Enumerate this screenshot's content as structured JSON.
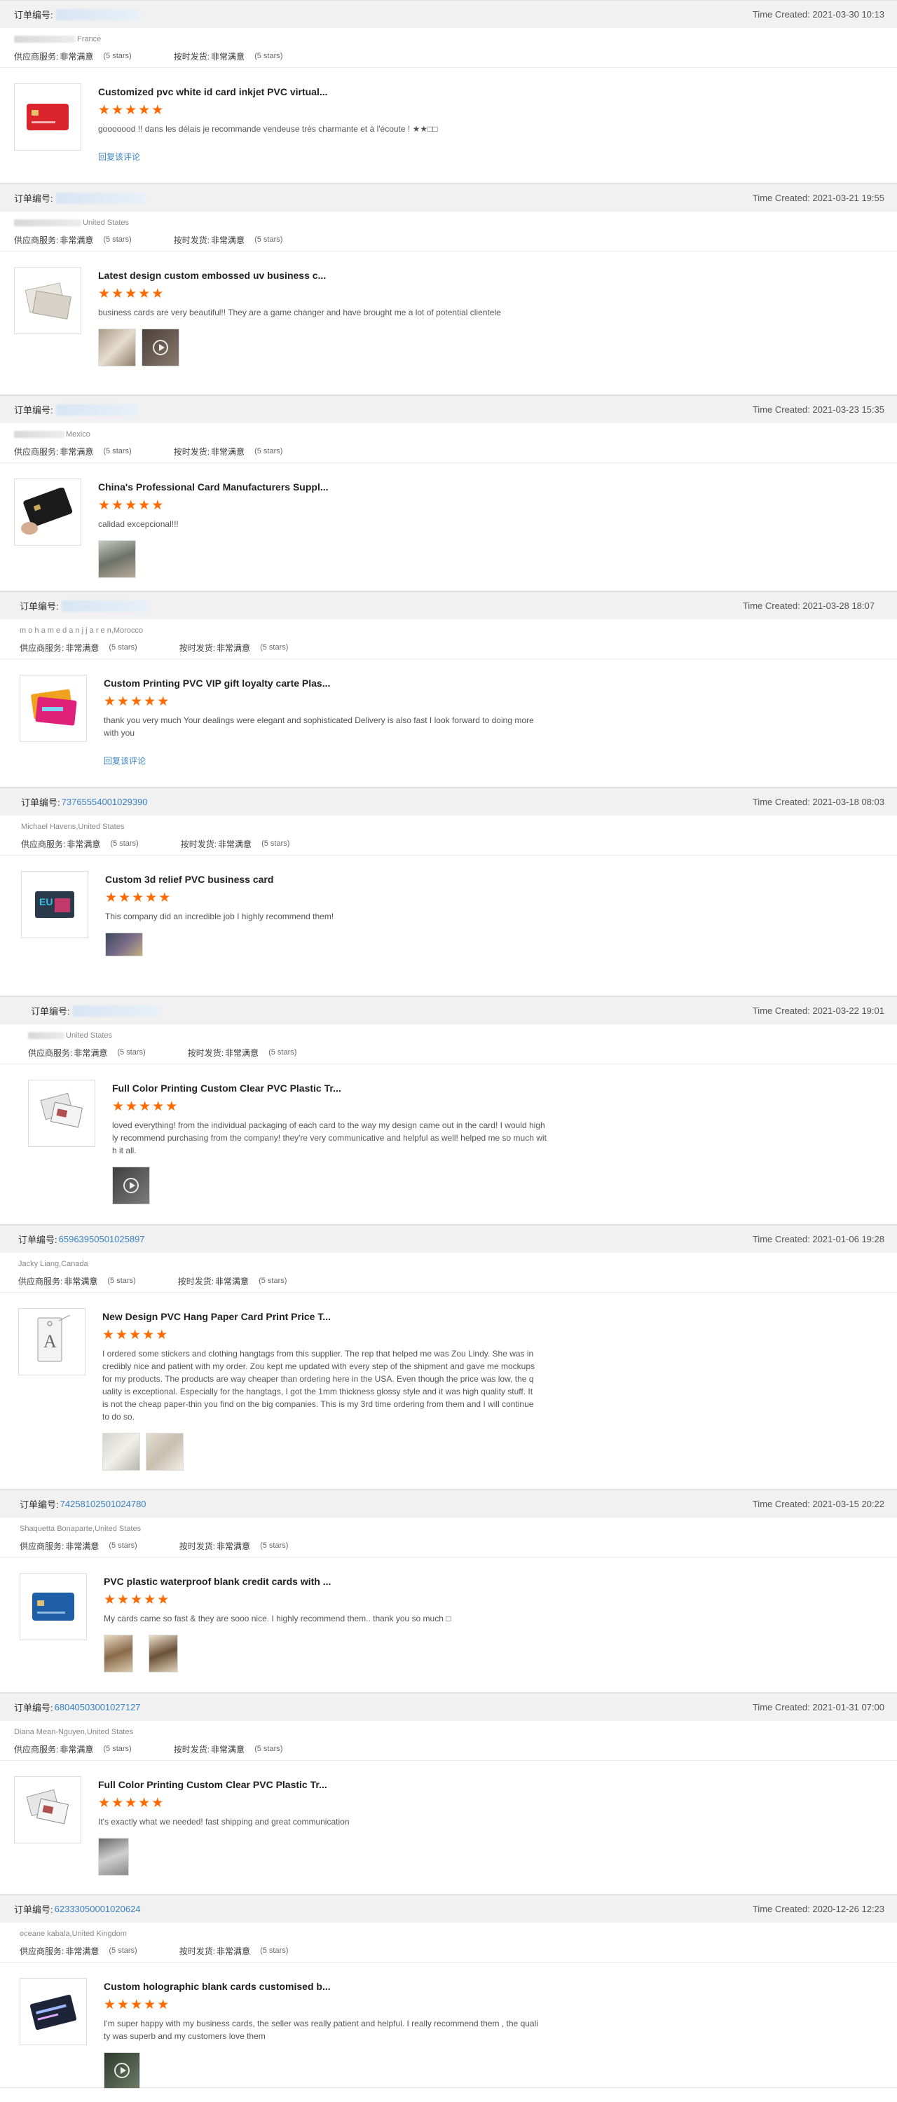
{
  "labels": {
    "order_prefix": "订单编号:",
    "service_label": "供应商服务:",
    "shipping_label": "按时发货:",
    "rating_value": "非常满意",
    "stars_text": "(5 stars)",
    "reply_label": "回复该评论",
    "time_prefix": "Time Created: "
  },
  "reviews": [
    {
      "order": "",
      "time": "2021-03-30 10:13",
      "customer": "France",
      "title": "Customized pvc white id card inkjet PVC virtual...",
      "text": "gooooood !! dans les délais je recommande vendeuse très charmante et à l'écoute ! ★★□□",
      "reply": true,
      "photos": 0
    },
    {
      "order": "",
      "time": "2021-03-21 19:55",
      "customer": "United States",
      "title": "Latest design custom embossed uv business c...",
      "text": "business cards are very beautiful!! They are a game changer and have brought me a lot of potential clientele",
      "reply": false,
      "photos": 2
    },
    {
      "order": "",
      "time": "2021-03-23 15:35",
      "customer": "Mexico",
      "title": "China's Professional Card Manufacturers Suppl...",
      "text": "calidad excepcional!!!",
      "reply": false,
      "photos": 1
    },
    {
      "order": "",
      "time": "2021-03-28 18:07",
      "customer": "m o h a m e d a n j j a r e n,Morocco",
      "title": "Custom Printing PVC VIP gift loyalty carte Plas...",
      "text": "thank you very much Your dealings were elegant and sophisticated Delivery is also fast I look forward to doing more with you",
      "reply": true,
      "photos": 0
    },
    {
      "order": "73765554001029390",
      "time": "2021-03-18 08:03",
      "customer": "Michael Havens,United States",
      "title": "Custom 3d relief PVC business card",
      "text": "This company did an incredible job I highly recommend them!",
      "reply": false,
      "photos": 1
    },
    {
      "order": "",
      "time": "2021-03-22 19:01",
      "customer": "United States",
      "title": "Full Color Printing Custom Clear PVC Plastic Tr...",
      "text": "loved everything! from the individual packaging of each card to the way my design came out in the card! I would highly recommend purchasing from the company! they're very communicative and helpful as well! helped me so much with it all.",
      "reply": false,
      "photos": 1
    },
    {
      "order": "65963950501025897",
      "time": "2021-01-06 19:28",
      "customer": "Jacky Liang,Canada",
      "title": "New Design PVC Hang Paper Card Print Price T...",
      "text": "I ordered some stickers and clothing hangtags from this supplier. The rep that helped me was Zou Lindy. She was incredibly nice and patient with my order. Zou kept me updated with every step of the shipment and gave me mockups for my products. The products are way cheaper than ordering here in the USA. Even though the price was low, the quality is exceptional. Especially for the hangtags, I got the 1mm thickness glossy style and it was high quality stuff. It is not the cheap paper-thin you find on the big companies. This is my 3rd time ordering from them and I will continue to do so.",
      "reply": false,
      "photos": 2
    },
    {
      "order": "74258102501024780",
      "time": "2021-03-15 20:22",
      "customer": "Shaquetta Bonaparte,United States",
      "title": "PVC plastic waterproof blank credit cards with ...",
      "text": "My cards came so fast & they are sooo nice. I highly recommend them.. thank you so much □",
      "reply": false,
      "photos": 2
    },
    {
      "order": "68040503001027127",
      "time": "2021-01-31 07:00",
      "customer": "Diana Mean-Nguyen,United States",
      "title": "Full Color Printing Custom Clear PVC Plastic Tr...",
      "text": "It's exactly what we needed! fast shipping and great communication",
      "reply": false,
      "photos": 1
    },
    {
      "order": "62333050001020624",
      "time": "2020-12-26 12:23",
      "customer": "oceane kabala,United Kingdom",
      "title": "Custom holographic blank cards customised b...",
      "text": "I'm super happy with my business cards, the seller was really patient and helpful. I really recommend them , the quality was superb and my customers love them",
      "reply": false,
      "photos": 1
    }
  ]
}
